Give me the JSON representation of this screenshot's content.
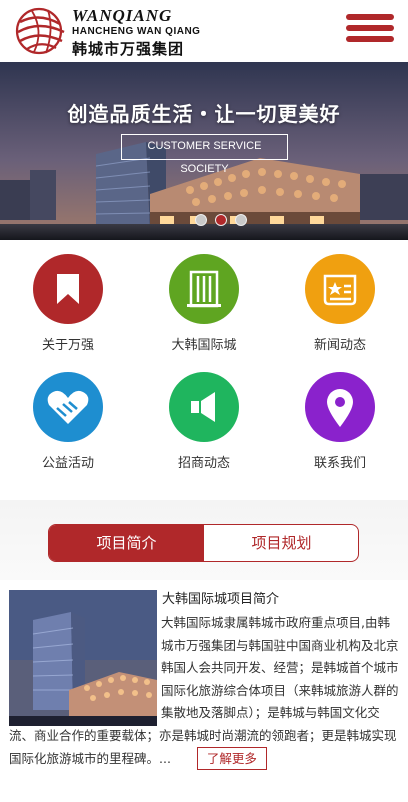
{
  "header": {
    "logo_en": "WANQIANG",
    "logo_en_sub": "HANCHENG WAN QIANG",
    "logo_cn": "韩城市万强集团",
    "menu_icon": "hamburger-menu-icon"
  },
  "banner": {
    "title": "创造品质生活・让一切更美好",
    "subtitle": "CUSTOMER SERVICE SOCIETY",
    "slide_count": 3,
    "active_slide": 2
  },
  "nav_grid": [
    {
      "label": "关于万强",
      "icon": "bookmark-icon",
      "color": "#b0282a"
    },
    {
      "label": "大韩国际城",
      "icon": "building-icon",
      "color": "#5fa521"
    },
    {
      "label": "新闻动态",
      "icon": "news-icon",
      "color": "#f0a010"
    },
    {
      "label": "公益活动",
      "icon": "heart-hands-icon",
      "color": "#1e8ed0"
    },
    {
      "label": "招商动态",
      "icon": "megaphone-icon",
      "color": "#1fb55e"
    },
    {
      "label": "联系我们",
      "icon": "location-pin-icon",
      "color": "#8a22cc"
    }
  ],
  "tabs": {
    "active": "项目简介",
    "inactive": "项目规划"
  },
  "article": {
    "title": "大韩国际城项目简介",
    "body": "大韩国际城隶属韩城市政府重点项目,由韩城市万强集团与韩国驻中国商业机构及北京韩国人会共同开发、经营；是韩城首个城市国际化旅游综合体项目（来韩城旅游人群的集散地及落脚点）；是韩城与韩国文化交流、商业合作的重要载体；亦是韩城时尚潮流的领跑者；更是韩城实现国际化旅游城市的里程碑。...",
    "more_label": "了解更多"
  },
  "colors": {
    "brand": "#b0282a"
  }
}
